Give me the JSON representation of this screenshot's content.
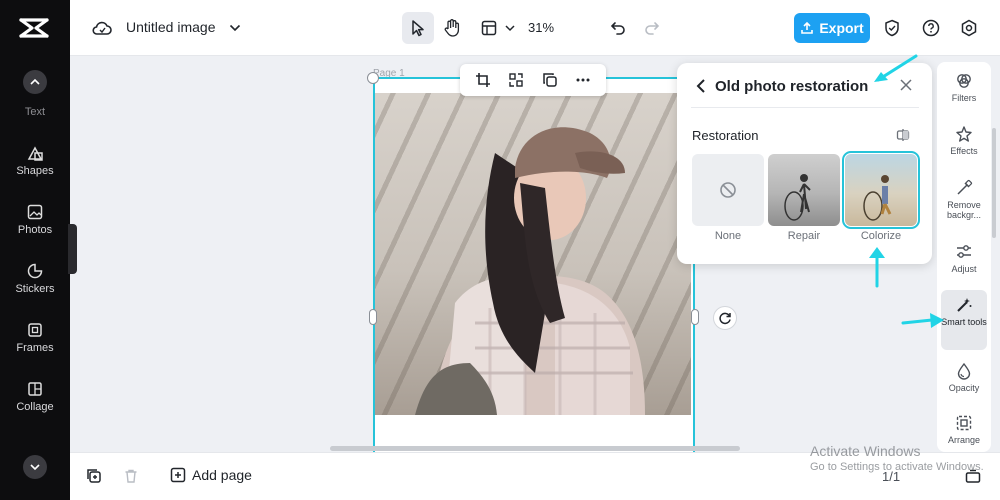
{
  "app": {
    "doc_title": "Untitled image",
    "zoom": "31%",
    "export_label": "Export",
    "accent": "#1da1f2",
    "selection_color": "#26c3d9"
  },
  "sidebar": {
    "items": [
      {
        "label": "Text",
        "icon": "text-icon"
      },
      {
        "label": "Shapes",
        "icon": "shapes-icon"
      },
      {
        "label": "Photos",
        "icon": "photos-icon"
      },
      {
        "label": "Stickers",
        "icon": "stickers-icon"
      },
      {
        "label": "Frames",
        "icon": "frames-icon"
      },
      {
        "label": "Collage",
        "icon": "collage-icon"
      }
    ]
  },
  "canvas": {
    "page_label": "Page 1"
  },
  "panel": {
    "title": "Old photo restoration",
    "section": "Restoration",
    "options": [
      {
        "label": "None"
      },
      {
        "label": "Repair"
      },
      {
        "label": "Colorize",
        "selected": true
      }
    ]
  },
  "rail": {
    "items": [
      {
        "label": "Filters",
        "icon": "filters-icon"
      },
      {
        "label": "Effects",
        "icon": "effects-icon"
      },
      {
        "label": "Remove backgr...",
        "icon": "remove-background-icon"
      },
      {
        "label": "Adjust",
        "icon": "adjust-icon"
      },
      {
        "label": "Smart tools",
        "icon": "smart-tools-icon",
        "active": true
      },
      {
        "label": "Opacity",
        "icon": "opacity-icon"
      },
      {
        "label": "Arrange",
        "icon": "arrange-icon"
      }
    ]
  },
  "bottom": {
    "add_page": "Add page",
    "pager": "1/1"
  },
  "watermark": {
    "line1": "Activate Windows",
    "line2": "Go to Settings to activate Windows."
  }
}
